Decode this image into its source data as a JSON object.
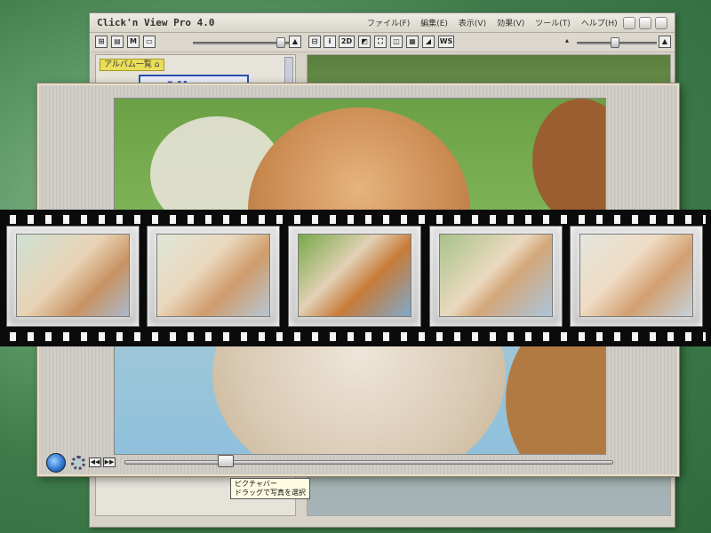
{
  "app": {
    "title": "Click'n View Pro 4.0",
    "menu": [
      "ファイル(F)",
      "編集(E)",
      "表示(V)",
      "効果(V)",
      "ツール(T)",
      "ヘルプ(H)"
    ]
  },
  "toolbar": {
    "view_2d_label": "2D",
    "ws_label": "WS",
    "m_label": "M"
  },
  "left_pane": {
    "tab_label": "アルバム一覧",
    "album_title": "Album"
  },
  "viewer": {
    "seek_position": 0.19
  },
  "status_tip": {
    "line1": "ピクチャバー",
    "line2": "ドラッグで写真を選択"
  },
  "colors": {
    "film": "#0b0b0b",
    "album_border": "#2b4fb0",
    "tab_yellow": "#e9de5a"
  },
  "filmstrip": {
    "frame_count": 5,
    "selected_index": 2
  }
}
